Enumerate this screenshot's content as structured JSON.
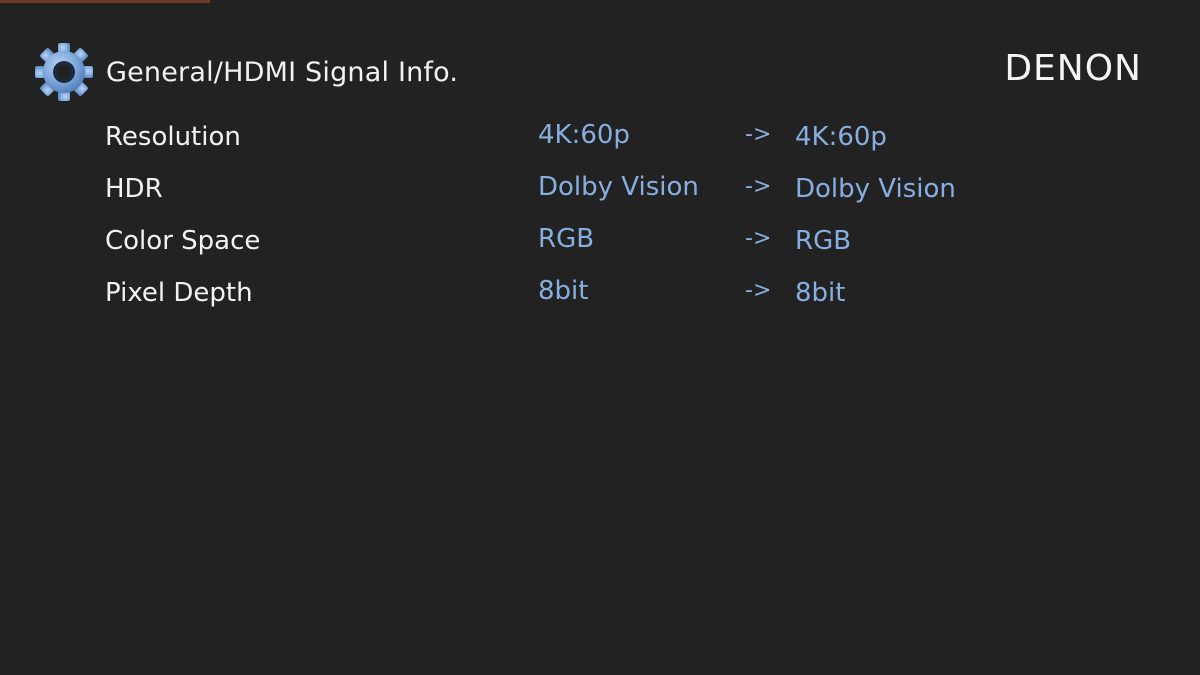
{
  "header": {
    "title": "General/HDMI Signal Info.",
    "icon": "gear-icon",
    "brand": "DENON"
  },
  "signal_info": {
    "rows": [
      {
        "label": "Resolution",
        "input": "4K:60p",
        "arrow": "->",
        "output": "4K:60p"
      },
      {
        "label": "HDR",
        "input": "Dolby Vision",
        "arrow": "->",
        "output": "Dolby Vision"
      },
      {
        "label": "Color Space",
        "input": "RGB",
        "arrow": "->",
        "output": "RGB"
      },
      {
        "label": "Pixel Depth",
        "input": "8bit",
        "arrow": "->",
        "output": "8bit"
      }
    ]
  },
  "colors": {
    "background": "#222222",
    "label_text": "#f2f2f2",
    "value_text": "#87aee0",
    "gear_icon": "#7fa9dc"
  }
}
